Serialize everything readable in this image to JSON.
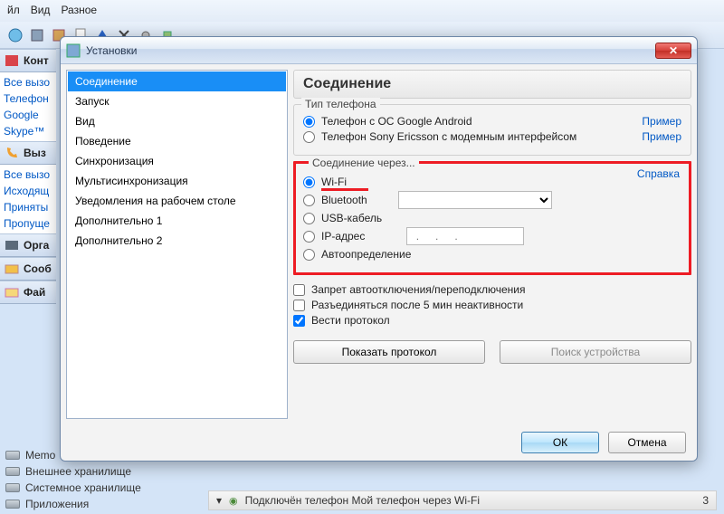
{
  "menu": {
    "file": "йл",
    "view": "Вид",
    "misc": "Разное"
  },
  "toolbar_icons": [
    "globe",
    "grid",
    "radio",
    "book",
    "page",
    "up",
    "cross",
    "gear",
    "plug",
    "link",
    "chart"
  ],
  "side": {
    "sections": {
      "contacts": "Конт",
      "calls": "Выз",
      "organizer": "Орга",
      "messages": "Сооб",
      "files": "Фай"
    },
    "call_links": [
      "Все вызо",
      "Телефон",
      "Google",
      "Skype™"
    ],
    "calls2": [
      "Все вызо",
      "Исходящ",
      "Приняты",
      "Пропуще"
    ]
  },
  "lower": [
    "Memo",
    "Внешнее хранилище",
    "Системное хранилище",
    "Приложения"
  ],
  "dialog": {
    "title": "Установки",
    "nav": [
      "Соединение",
      "Запуск",
      "Вид",
      "Поведение",
      "Синхронизация",
      "Мультисинхронизация",
      "Уведомления на рабочем столе",
      "Дополнительно 1",
      "Дополнительно 2"
    ],
    "heading": "Соединение",
    "group1": {
      "name": "Тип телефона",
      "opt1": "Телефон с ОС Google Android",
      "opt2": "Телефон Sony Ericsson с модемным интерфейсом",
      "example": "Пример"
    },
    "group2": {
      "name": "Соединение через...",
      "help": "Справка",
      "opts": [
        "Wi-Fi",
        "Bluetooth",
        "USB-кабель",
        "IP-адрес",
        "Автоопределение"
      ],
      "ip_placeholder": " .   .   .   "
    },
    "checks": {
      "c1": "Запрет автоотключения/переподключения",
      "c2": "Разъединяться после 5 мин неактивности",
      "c3": "Вести протокол"
    },
    "btns": {
      "show": "Показать протокол",
      "find": "Поиск устройства",
      "ok": "ОК",
      "cancel": "Отмена"
    }
  },
  "status": {
    "text": "Подключён телефон Мой телефон через Wi-Fi",
    "count": "3",
    "chev": "▾",
    "wifi": "⬤"
  }
}
